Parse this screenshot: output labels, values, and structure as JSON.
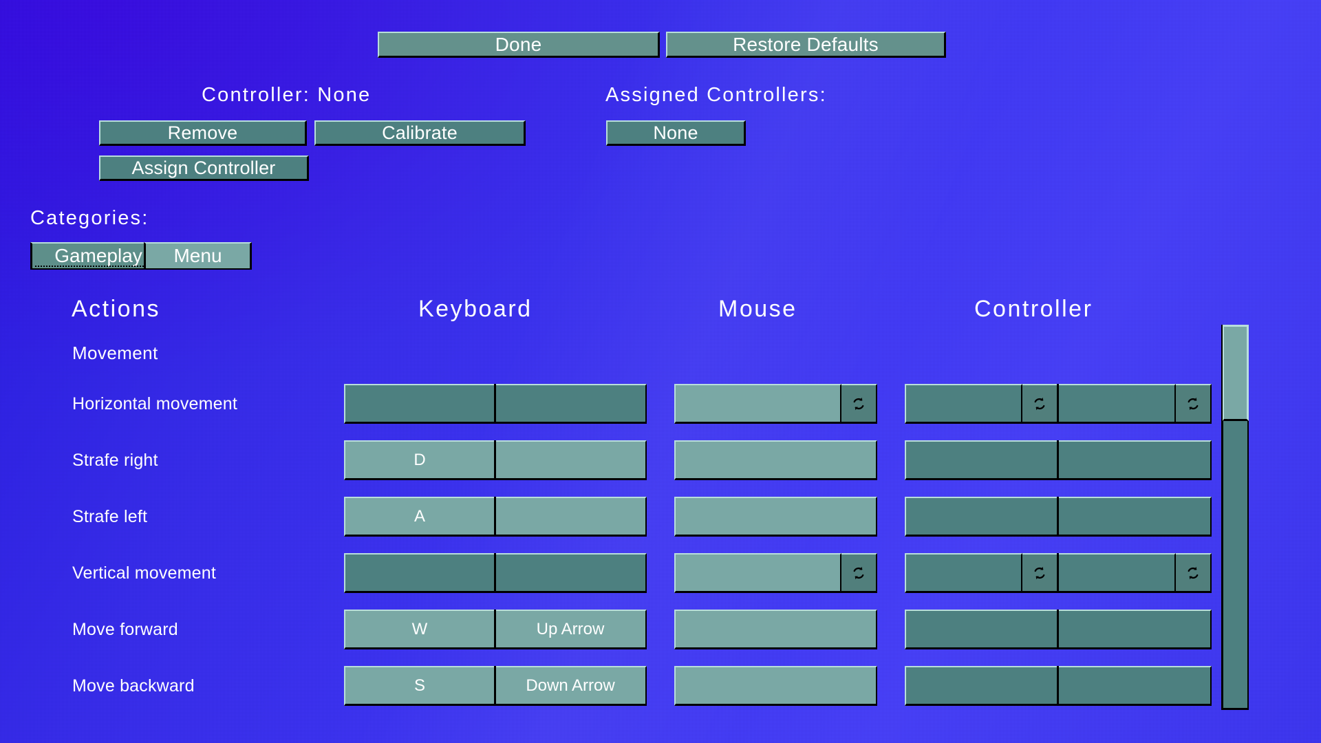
{
  "screen": {
    "name": "Controls / Key Bindings Settings",
    "background_color": "#3a2ff2"
  },
  "top_buttons": {
    "done_label": "Done",
    "restore_defaults_label": "Restore Defaults"
  },
  "controller_panel": {
    "controller_status_label": "Controller:  None",
    "assigned_controllers_label": "Assigned Controllers:",
    "remove_label": "Remove",
    "calibrate_label": "Calibrate",
    "assign_controller_label": "Assign Controller",
    "assigned_none_label": "None"
  },
  "categories": {
    "heading": "Categories:",
    "tabs": [
      {
        "label": "Gameplay",
        "selected": true,
        "focused": true
      },
      {
        "label": "Menu",
        "selected": false,
        "focused": false
      }
    ]
  },
  "bindings_table": {
    "columns": [
      {
        "label": "Actions"
      },
      {
        "label": "Keyboard"
      },
      {
        "label": "Mouse"
      },
      {
        "label": "Controller"
      }
    ],
    "groups": [
      {
        "label": "Movement"
      }
    ],
    "rows": [
      {
        "action": "Horizontal movement",
        "type": "axis",
        "keyboard": [
          {
            "value": "",
            "enabled": false
          },
          {
            "value": "",
            "enabled": false
          }
        ],
        "mouse": [
          {
            "value": "",
            "enabled": true
          }
        ],
        "mouse_reverse_icon": "reverse-axis-icon",
        "controller": [
          {
            "value": "",
            "enabled": true
          },
          {
            "value": "",
            "enabled": true
          }
        ],
        "controller_reverse_icons": [
          "reverse-axis-icon",
          "reverse-axis-icon"
        ]
      },
      {
        "action": "Strafe right",
        "type": "button",
        "keyboard": [
          {
            "value": "D",
            "enabled": true
          },
          {
            "value": "",
            "enabled": true
          }
        ],
        "mouse": [
          {
            "value": "",
            "enabled": true
          }
        ],
        "mouse_reverse_icon": null,
        "controller": [
          {
            "value": "",
            "enabled": true
          },
          {
            "value": "",
            "enabled": true
          }
        ],
        "controller_reverse_icons": []
      },
      {
        "action": "Strafe left",
        "type": "button",
        "keyboard": [
          {
            "value": "A",
            "enabled": true
          },
          {
            "value": "",
            "enabled": true
          }
        ],
        "mouse": [
          {
            "value": "",
            "enabled": true
          }
        ],
        "mouse_reverse_icon": null,
        "controller": [
          {
            "value": "",
            "enabled": true
          },
          {
            "value": "",
            "enabled": true
          }
        ],
        "controller_reverse_icons": []
      },
      {
        "action": "Vertical movement",
        "type": "axis",
        "keyboard": [
          {
            "value": "",
            "enabled": false
          },
          {
            "value": "",
            "enabled": false
          }
        ],
        "mouse": [
          {
            "value": "",
            "enabled": true
          }
        ],
        "mouse_reverse_icon": "reverse-axis-icon",
        "controller": [
          {
            "value": "",
            "enabled": true
          },
          {
            "value": "",
            "enabled": true
          }
        ],
        "controller_reverse_icons": [
          "reverse-axis-icon",
          "reverse-axis-icon"
        ]
      },
      {
        "action": "Move forward",
        "type": "button",
        "keyboard": [
          {
            "value": "W",
            "enabled": true
          },
          {
            "value": "Up Arrow",
            "enabled": true
          }
        ],
        "mouse": [
          {
            "value": "",
            "enabled": true
          }
        ],
        "mouse_reverse_icon": null,
        "controller": [
          {
            "value": "",
            "enabled": true
          },
          {
            "value": "",
            "enabled": true
          }
        ],
        "controller_reverse_icons": []
      },
      {
        "action": "Move backward",
        "type": "button",
        "keyboard": [
          {
            "value": "S",
            "enabled": true
          },
          {
            "value": "Down Arrow",
            "enabled": true
          }
        ],
        "mouse": [
          {
            "value": "",
            "enabled": true
          }
        ],
        "mouse_reverse_icon": null,
        "controller": [
          {
            "value": "",
            "enabled": true
          },
          {
            "value": "",
            "enabled": true
          }
        ],
        "controller_reverse_icons": []
      }
    ]
  },
  "scrollbar": {
    "orientation": "vertical",
    "thumb_position": "top"
  },
  "colors": {
    "panel_light": "#7aa8a5",
    "panel_mid": "#64918c",
    "panel_dark": "#4d8080",
    "bevel_highlight": "#b9dedc",
    "bevel_shadow": "#000000",
    "text": "#ffffff"
  }
}
